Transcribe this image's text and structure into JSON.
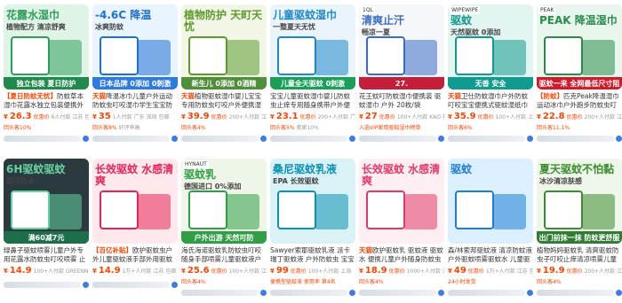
{
  "products": [
    {
      "id": "p1",
      "thumb": {
        "bg": "#dff3e6",
        "accent": "#2e9e5a",
        "big": "花露水湿巾",
        "sub": "植物配方 清凉舒爽",
        "strip": "独立包装  夏日防护",
        "strip_bg": "#1f8a4c",
        "badge": ""
      },
      "tag": "【夏日防蚊无忧】",
      "title": "防蚊草本湿巾花露水独立包装便携外出清凉舒爽",
      "price": "26.3",
      "price_note": "优惠价",
      "sales": "6人付款",
      "location": "江苏",
      "service": "包邮",
      "extra": "回头客10%",
      "extra2": ""
    },
    {
      "id": "p2",
      "thumb": {
        "bg": "#e8f4ff",
        "accent": "#1f6fd1",
        "big": "-4.6C 降温",
        "sub": "冰爽防蚊",
        "strip": "日本品牌  0添加 0刺激",
        "strip_bg": "#2d7be0",
        "badge": ""
      },
      "tag": "天猫",
      "title": "降温冰巾儿童户外运动防蚊虫叮咬湿巾学生宝宝防晒降温",
      "price": "35",
      "price_note": "",
      "sales": "1人付款",
      "location": "广东 深圳",
      "service": "包邮",
      "extra": "回头客8%",
      "extra2": "好评率高"
    },
    {
      "id": "p3",
      "thumb": {
        "bg": "#f1f6e6",
        "accent": "#5c9a2d",
        "big": "植物防护  天町天忧",
        "sub": "",
        "strip": "新生儿 0添加 0酒精",
        "strip_bg": "#4f8f3a",
        "badge": ""
      },
      "tag": "天猫",
      "title": "植物驱蚊湿巾婴儿宝宝专用防蚊虫叮咬户外便携湿纸巾包装",
      "price": "39.9",
      "price_note": "优惠价",
      "sales": "200+人付款",
      "location": "江苏",
      "service": "包邮",
      "extra": "回头客4%",
      "extra2": ""
    },
    {
      "id": "p4",
      "thumb": {
        "bg": "#eaf4fb",
        "accent": "#1e88c9",
        "big": "儿童驱蚊湿巾",
        "sub": "一整夏天无忧",
        "strip": "儿童全天驱蚊  0刺激",
        "strip_bg": "#18a058",
        "badge": ""
      },
      "tag": "",
      "title": "宝宝儿童驱蚊湿巾婴儿防蚊虫止痒专用随身携带户外便携湿巾",
      "price": "23.1",
      "price_note": "优惠价",
      "sales": "200+人付款",
      "location": "广州",
      "service": "包邮",
      "extra": "回头客5%",
      "extra2": "卖家10%"
    },
    {
      "id": "p5",
      "thumb": {
        "bg": "#f6f7fb",
        "accent": "#3b6cc4",
        "big": "清爽止汗",
        "sub": "畅凉一夏",
        "strip": "27.  ",
        "strip_bg": "#c41e3a",
        "badge": "1QL"
      },
      "tag": "",
      "title": "花王蚊叮防蚊湿巾便携装 驱蚊湿巾 户外 20枚/袋",
      "price": "27",
      "price_note": "优惠价",
      "sales": "100+人付款",
      "location": "KAO 花王",
      "service": "",
      "extra": "入选VIP家用驱蚊湿巾榜单",
      "extra2": ""
    },
    {
      "id": "p6",
      "thumb": {
        "bg": "#e3f5f1",
        "accent": "#11998e",
        "big": "驱蚊",
        "sub": "天然驱蚊  0添加",
        "strip": "无香  安全",
        "strip_bg": "#0f9b8e",
        "badge": "WIPEWIPE"
      },
      "tag": "天猫",
      "title": "卫仕防蚊湿巾户外防蚊叮咬宝宝便携式驱蚊湿纸巾",
      "price": "35.9",
      "price_note": "优惠价",
      "sales": "100+人付款",
      "location": "上海",
      "service": "包邮",
      "extra": "回头客6%",
      "extra2": ""
    },
    {
      "id": "p7",
      "thumb": {
        "bg": "#e9f6ee",
        "accent": "#2a8c4a",
        "big": "PEAK 降温湿巾",
        "sub": "",
        "strip": "驱蚊一来 全网最低尺寸阻",
        "strip_bg": "#d11a2a",
        "badge": "PEAK"
      },
      "tag": "【防蚊】",
      "title": "匹克Peak降温湿巾运动冰巾户外跑步防蚊虫叮咬湿巾清凉",
      "price": "22.8",
      "price_note": "优惠价",
      "sales": "200+人付款",
      "location": "江苏",
      "service": "包邮",
      "extra": "回头客11.1%",
      "extra2": ""
    },
    {
      "id": "p8",
      "thumb": {
        "bg": "#2b3a3f",
        "accent": "#66d1a0",
        "big": "6H驱蚊驱蚊",
        "sub": "防汗防水",
        "strip": "满60减7元",
        "strip_bg": "#1d6f4c",
        "badge": ""
      },
      "tag": "",
      "title": "绿鼻子驱蚊喷雾儿童户外专用花露水防蚊虫叮咬喷雾 止痒膏",
      "price": "14.9",
      "price_note": "",
      "sales": "100+人付款",
      "location": "GREENNOSE/绿鼻子",
      "service": "包邮",
      "extra": "",
      "extra2": ""
    },
    {
      "id": "p9",
      "thumb": {
        "bg": "#ffe9ec",
        "accent": "#e5245a",
        "big": "长效驱蚊 水感清爽",
        "sub": "",
        "strip": "",
        "strip_bg": "#e5245a",
        "badge": ""
      },
      "tag": "【百亿补贴】",
      "title": "欧护驱蚊虫户外儿童驱蚊液手部外用驱蚊水宝宝 婴儿孕妇",
      "price": "14.9",
      "price_note": "",
      "sales": "1万+人付款",
      "location": "江苏",
      "service": "包邮",
      "extra": "",
      "extra2": ""
    },
    {
      "id": "p10",
      "thumb": {
        "bg": "#eef6e8",
        "accent": "#2f9e44",
        "big": "驱蚊乳",
        "sub": "德国进口  0%添加",
        "strip": "户外出游  天然可防",
        "strip_bg": "#2f9e44",
        "badge": "HYNAUT"
      },
      "tag": "",
      "title": "海氏海诺驱蚊乳防蚊虫叮咬随身手部喷雾儿童驱蚊液户外50g",
      "price": "25.6",
      "price_note": "优惠价",
      "sales": "100+人付款",
      "location": "江苏",
      "service": "包邮",
      "extra": "回头客4%",
      "extra2": ""
    },
    {
      "id": "p11",
      "thumb": {
        "bg": "#d9f2f6",
        "accent": "#0c91b3",
        "big": "桑尼驱蚊乳液",
        "sub": "EPA 长效驱蚊",
        "strip": "",
        "strip_bg": "#0c91b3",
        "badge": ""
      },
      "tag": "",
      "title": "Sawyer索耶驱蚊乳液 派卡瑞丁驱蚊液 户外防蚊虫 宝宝",
      "price": "99",
      "price_note": "优惠价",
      "sales": "100+人付款",
      "location": "上海",
      "service": "",
      "extra": "便携型驱蚊液 使用率 第4名",
      "extra2": ""
    },
    {
      "id": "p12",
      "thumb": {
        "bg": "#ffeef2",
        "accent": "#e03a6a",
        "big": "长效驱蚊 水感清爽",
        "sub": "",
        "strip": "",
        "strip_bg": "#e03a6a",
        "badge": ""
      },
      "tag": "天猫",
      "title": "欧护驱蚊乳 驱蚊液 驱蚊水 便携儿童户外随身防蚊虫 婴儿",
      "price": "18.9",
      "price_note": "优惠价",
      "sales": "1000+人付款",
      "location": "江苏",
      "service": "包邮",
      "extra": "回头客4%",
      "extra2": ""
    },
    {
      "id": "p13",
      "thumb": {
        "bg": "#dcefff",
        "accent": "#1c7ed6",
        "big": "驱蚊",
        "sub": "",
        "strip": "",
        "strip_bg": "#1c7ed6",
        "badge": ""
      },
      "tag": "",
      "title": "森/林索邦驱蚊液 清凉防蚊液 户外驱蚊喷雾驱蚊水 儿童驱蚊",
      "price": "49",
      "price_note": "优惠价",
      "sales": "1万+人付款",
      "location": "江苏",
      "service": "包邮",
      "extra": "24小时发货",
      "extra2": ""
    },
    {
      "id": "p14",
      "thumb": {
        "bg": "#eef7e9",
        "accent": "#3c8d2f",
        "big": "夏天驱蚊不怕黏",
        "sub": "冰沙清凉肤感",
        "strip": "出门前抹一抹  防蚊更舒服",
        "strip_bg": "#2f7d32",
        "badge": ""
      },
      "tag": "",
      "title": "植物妈妈驱蚊乳 清爽驱蚊防虫子叮咬止痒清凉喷雾儿童孕妇",
      "price": "19.9",
      "price_note": "优惠价",
      "sales": "200+人付款",
      "location": "江苏",
      "service": "包邮",
      "extra": "回头客4%",
      "extra2": ""
    }
  ]
}
